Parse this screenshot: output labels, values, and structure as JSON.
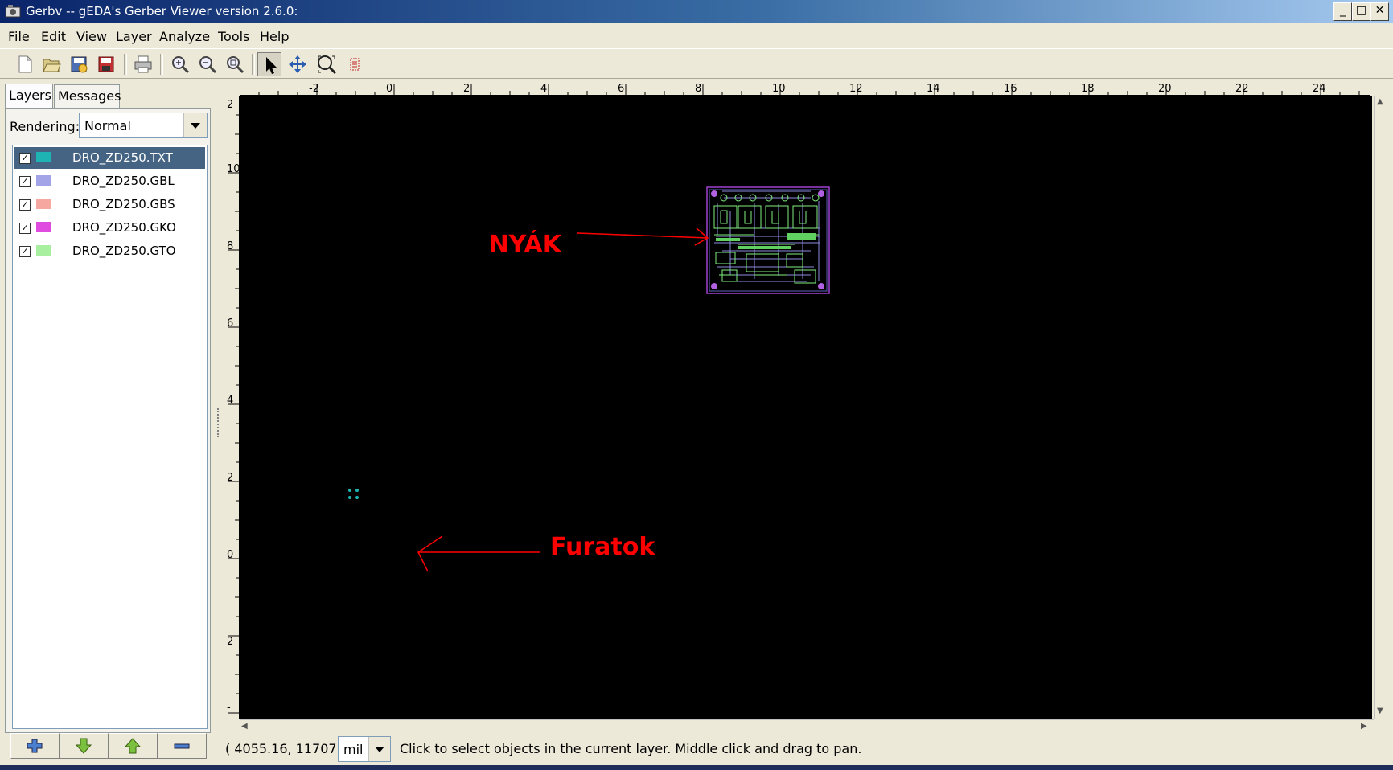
{
  "window": {
    "title": "Gerbv -- gEDA's Gerber Viewer version 2.6.0:",
    "min_glyph": "_",
    "max_glyph": "□",
    "close_glyph": "✕"
  },
  "menu": {
    "file": "File",
    "edit": "Edit",
    "view": "View",
    "layer": "Layer",
    "analyze": "Analyze",
    "tools": "Tools",
    "help": "Help"
  },
  "toolbar": {
    "icons": [
      "new-icon",
      "open-icon",
      "revert-icon",
      "save-icon",
      "print-icon",
      "zoom-in-icon",
      "zoom-out-icon",
      "zoom-fit-icon",
      "pointer-tool-icon",
      "pan-tool-icon",
      "zoom-tool-icon",
      "measure-tool-icon"
    ],
    "active_tool": "pointer-tool-icon"
  },
  "sidebar": {
    "tabs": {
      "layers": "Layers",
      "messages": "Messages",
      "selected": "Layers"
    },
    "rendering_label": "Rendering:",
    "rendering_value": "Normal",
    "layers": [
      {
        "name": "DRO_ZD250.TXT",
        "color": "#1eb4b4",
        "checked": true,
        "selected": true
      },
      {
        "name": "DRO_ZD250.GBL",
        "color": "#a3a3e8",
        "checked": true,
        "selected": false
      },
      {
        "name": "DRO_ZD250.GBS",
        "color": "#f6a7a0",
        "checked": true,
        "selected": false
      },
      {
        "name": "DRO_ZD250.GKO",
        "color": "#e04ce0",
        "checked": true,
        "selected": false
      },
      {
        "name": "DRO_ZD250.GTO",
        "color": "#a8f0a0",
        "checked": true,
        "selected": false
      }
    ],
    "check_glyph": "✓",
    "buttons": [
      "add-layer-icon",
      "move-layer-down-icon",
      "move-layer-up-icon",
      "remove-layer-icon"
    ]
  },
  "rulers": {
    "top_labels": [
      "-2",
      "0",
      "2",
      "4",
      "6",
      "8",
      "10",
      "12",
      "14",
      "16",
      "18",
      "20",
      "22",
      "24"
    ],
    "left_labels": [
      "2",
      "10",
      "8",
      "6",
      "4",
      "2",
      "0",
      "2",
      "-"
    ]
  },
  "annotations": {
    "pcb_label": "NYÁK",
    "holes_label": "Furatok",
    "color": "#ff0000"
  },
  "statusbar": {
    "coords": "( 4055.16, 11707.",
    "units": "mil",
    "message": "Click to select objects in the current layer. Middle click and drag to pan."
  }
}
